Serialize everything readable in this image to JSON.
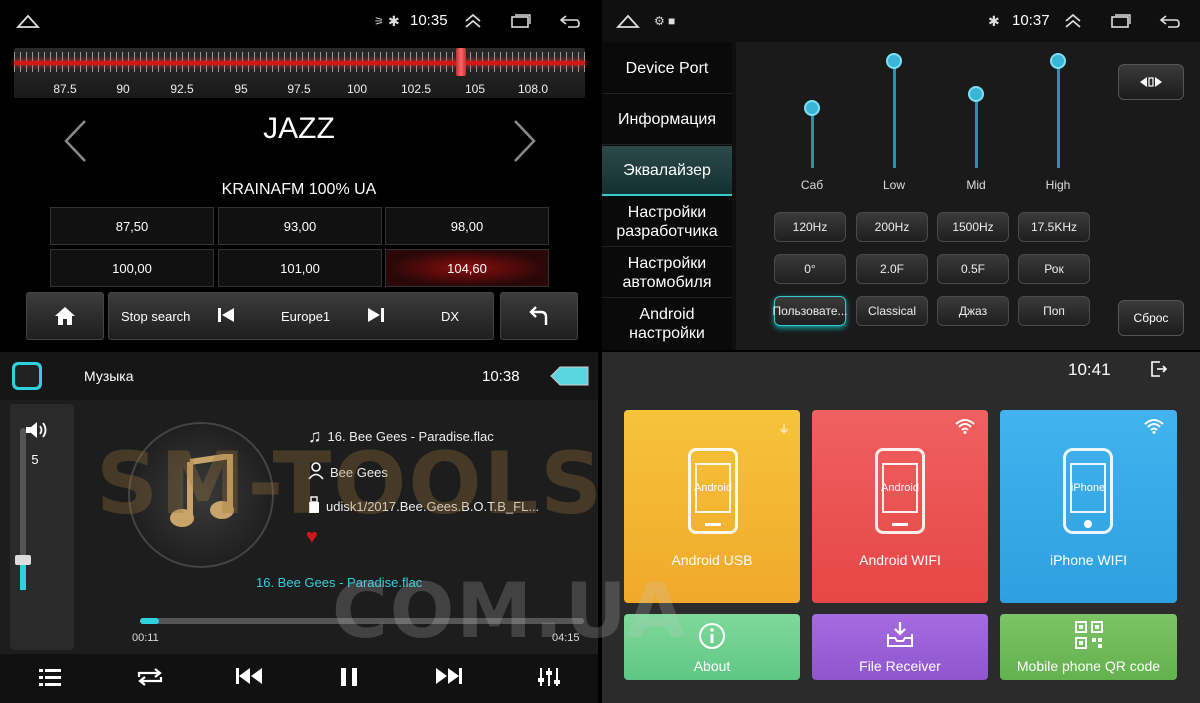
{
  "radio": {
    "time": "10:35",
    "freq_ticks": [
      "87.5",
      "90",
      "92.5",
      "95",
      "97.5",
      "100",
      "102.5",
      "105",
      "108.0"
    ],
    "tuned_frequency": 104.6,
    "genre": "JAZZ",
    "station": "KRAINAFM 100% UA",
    "presets": [
      "87,50",
      "93,00",
      "98,00",
      "100,00",
      "101,00",
      "104,60"
    ],
    "active_preset_index": 5,
    "controls": {
      "stop_search": "Stop search",
      "region": "Europe1",
      "dx": "DX"
    },
    "icons": [
      "home-icon",
      "android-home-icon",
      "back-icon",
      "bluetooth-icon",
      "previous-icon",
      "next-icon",
      "return-icon"
    ]
  },
  "settings": {
    "time": "10:37",
    "menu": [
      {
        "label": "Device Port"
      },
      {
        "label": "Информация"
      },
      {
        "label": "Эквалайзер"
      },
      {
        "label": "Настройки разработчика"
      },
      {
        "label": "Настройки автомобиля"
      },
      {
        "label": "Android настройки"
      }
    ],
    "active_menu_index": 2,
    "eq_bands": [
      {
        "name": "Саб",
        "level": 0.55
      },
      {
        "name": "Low",
        "level": 0.97
      },
      {
        "name": "Mid",
        "level": 0.67
      },
      {
        "name": "High",
        "level": 0.97
      }
    ],
    "freq_buttons": [
      "120Hz",
      "200Hz",
      "1500Hz",
      "17.5KHz"
    ],
    "q_buttons": [
      "0°",
      "2.0F",
      "0.5F",
      "Рок"
    ],
    "preset_buttons": [
      "Пользовате...",
      "Classical",
      "Джаз",
      "Поп"
    ],
    "selected_preset_index": 0,
    "reset_label": "Сброс"
  },
  "music": {
    "title": "Музыка",
    "time": "10:38",
    "volume": "5",
    "volume_level": 0.18,
    "track": "16. Bee Gees - Paradise.flac",
    "artist": "Bee Gees",
    "path": "udisk1/2017.Bee.Gees.B.O.T.B_FL...",
    "now_playing": "16. Bee Gees - Paradise.flac",
    "elapsed": "00:11",
    "duration": "04:15",
    "progress": 0.043
  },
  "phonelink": {
    "time": "10:41",
    "tiles": [
      {
        "label": "Android USB",
        "screen": "Android",
        "color": "#f5b52e"
      },
      {
        "label": "Android WIFI",
        "screen": "Android",
        "color": "#ee5050"
      },
      {
        "label": "iPhone WIFI",
        "screen": "iPhone",
        "color": "#35a8e8"
      }
    ],
    "small_tiles": [
      {
        "label": "About",
        "color": "#6fcf8f"
      },
      {
        "label": "File Receiver",
        "color": "#9a5fd6"
      },
      {
        "label": "Mobile phone QR code",
        "color": "#6db85a"
      }
    ]
  },
  "watermark": {
    "line1": "SM-TOOLS",
    "line2": "COM.UA"
  }
}
